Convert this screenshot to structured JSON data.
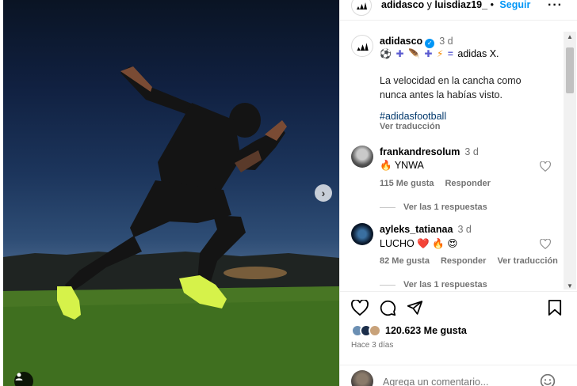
{
  "post": {
    "header": {
      "text": "adidasco y luisdiaz19_",
      "user1": "adidasco",
      "joiner": " y ",
      "user2": "luisdiaz19_",
      "bullet": " • ",
      "follow_label": "Seguir",
      "more_label": "···"
    },
    "caption": {
      "username": "adidasco",
      "verified_icon": "verified-badge-icon",
      "time": "3 d",
      "emoji_line_suffix": "adidas X.",
      "description": "La velocidad en la cancha como nunca antes la habías visto.",
      "hashtag": "#adidasfootball",
      "translate_label": "Ver traducción"
    },
    "comments": [
      {
        "username": "frankandresolum",
        "time": "3 d",
        "text_emoji": "🔥",
        "text": "YNWA",
        "likes": "115 Me gusta",
        "reply_label": "Responder",
        "translate_label": "",
        "replies_label": "Ver las 1 respuestas"
      },
      {
        "username": "ayleks_tatianaa",
        "time": "3 d",
        "text": "LUCHO",
        "text_emojis": "❤️ 🔥 😍",
        "likes": "82 Me gusta",
        "reply_label": "Responder",
        "translate_label": "Ver traducción",
        "replies_label": "Ver las 1 respuestas"
      }
    ],
    "actions": {
      "like_icon": "heart-icon",
      "comment_icon": "comment-icon",
      "share_icon": "share-icon",
      "save_icon": "bookmark-icon",
      "likes_count": "120.623",
      "likes_suffix": "Me gusta",
      "posted_ago": "Hace 3 días"
    },
    "comment_input": {
      "placeholder": "Agrega un comentario..."
    },
    "colors": {
      "link_blue": "#0095f6",
      "hashtag_blue": "#00376b",
      "muted_gray": "#737373",
      "boot_yellow": "#d6f24a"
    }
  }
}
